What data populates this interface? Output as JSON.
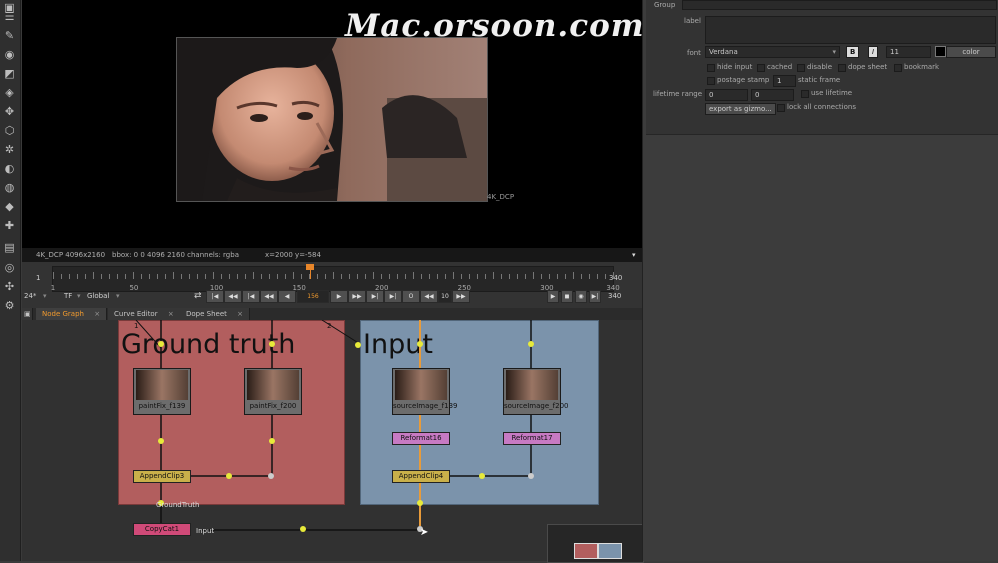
{
  "watermark": "Mac.orsoon.com",
  "viewer": {
    "format_label": "4K_DCP",
    "info_format": "4K_DCP 4096x2160",
    "info_bbox": "bbox: 0 0 4096 2160 channels: rgba",
    "info_coords": "x=2000 y=-584"
  },
  "timeline": {
    "start_frame": "1",
    "end_frame": "340",
    "end_frame_lower": "340",
    "ticks": [
      "1",
      "50",
      "100",
      "150",
      "200",
      "250",
      "300",
      "340"
    ],
    "current_frame": "156",
    "current_fraction": 0.459,
    "fps": "24*",
    "tf": "TF",
    "scope": "Global",
    "step": "10"
  },
  "tabs": [
    {
      "label": "Node Graph",
      "active": true
    },
    {
      "label": "Curve Editor",
      "active": false
    },
    {
      "label": "Dope Sheet",
      "active": false
    }
  ],
  "graph": {
    "backdrop_ground": "Ground truth",
    "backdrop_input": "Input",
    "nodes": [
      "paintFix_f139",
      "paintFix_f200",
      "sourceImage_f139",
      "sourceImage_f200"
    ],
    "reformat": [
      "Reformat16",
      "Reformat17"
    ],
    "append": [
      "AppendClip3",
      "AppendClip4"
    ],
    "copycat": "CopyCat1",
    "wire_groundtruth": "GroundTruth",
    "wire_input": "Input",
    "num1": "1",
    "num2": "2"
  },
  "properties": {
    "group_label": "Group",
    "label_label": "label",
    "font_label": "font",
    "font_value": "Verdana",
    "bold": "B",
    "italic": "I",
    "font_size": "11",
    "color_button": "color",
    "hide_input": "hide input",
    "cached": "cached",
    "disable": "disable",
    "dope_sheet": "dope sheet",
    "bookmark": "bookmark",
    "postage_stamp": "postage stamp",
    "static_frame_value": "1",
    "static_frame": "static frame",
    "lifetime_range": "lifetime range",
    "lifetime_start": "0",
    "lifetime_end": "0",
    "use_lifetime": "use lifetime",
    "export_gizmo": "export as gizmo...",
    "lock_connections": "lock all connections"
  },
  "colors": {
    "accent": "#f09a2e",
    "backdrop_ground": "#b25e5e",
    "backdrop_input": "#7b93ab",
    "reformat": "#c77ac3",
    "append": "#c9b04a",
    "copycat": "#d04a78"
  }
}
